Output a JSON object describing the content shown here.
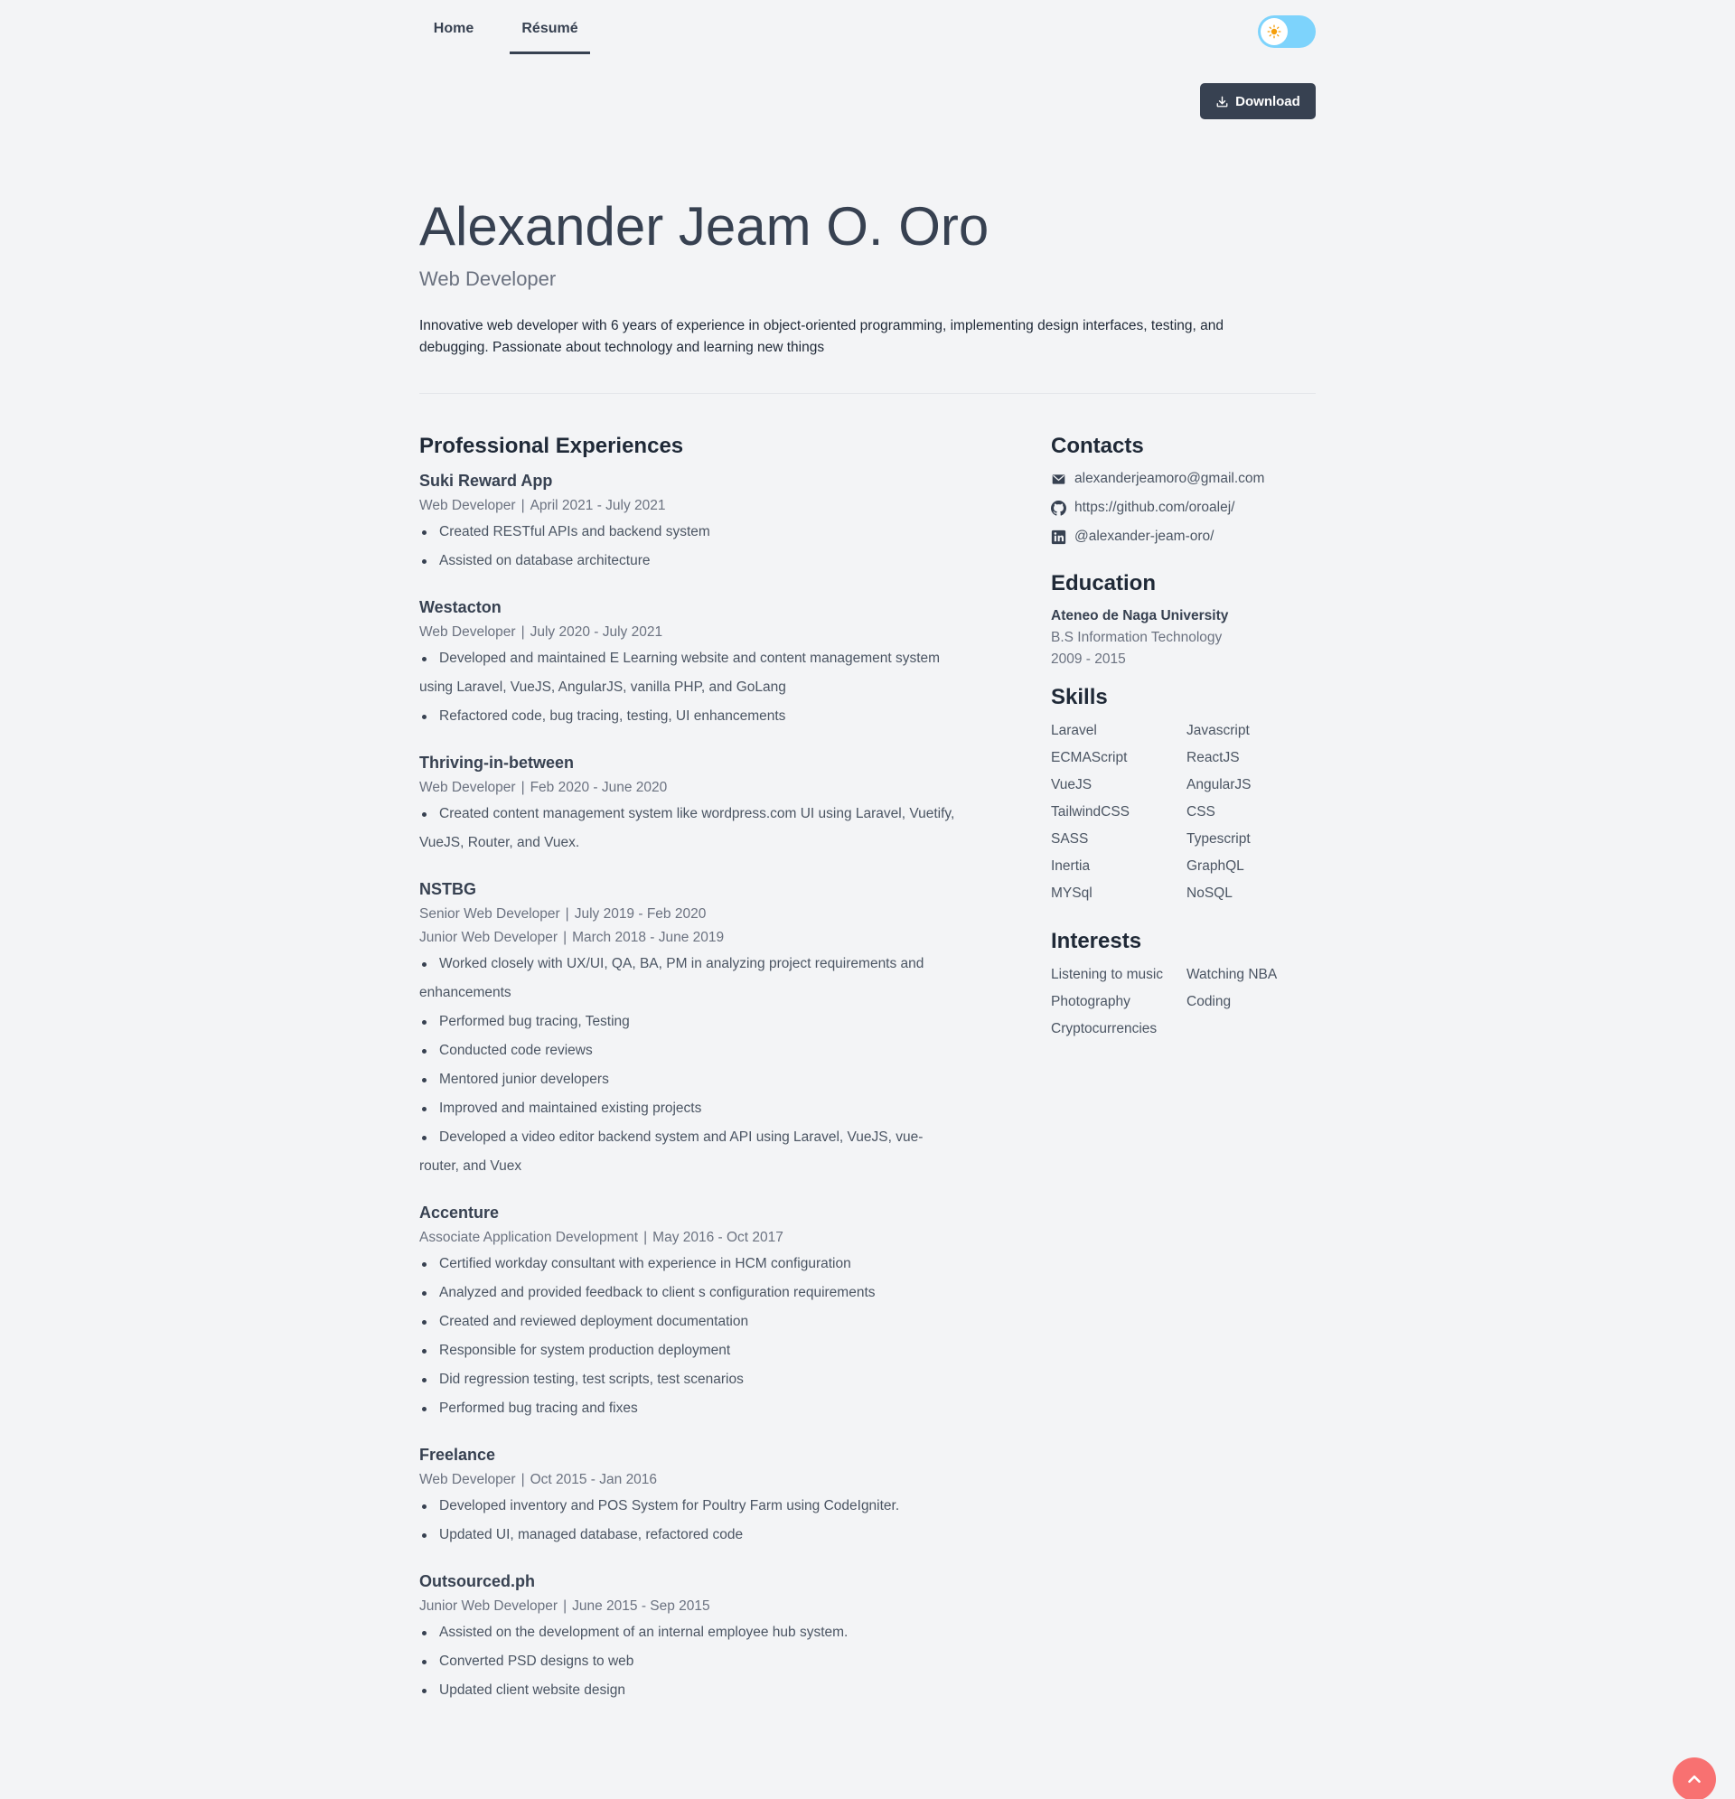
{
  "nav": {
    "tabs": [
      {
        "label": "Home"
      },
      {
        "label": "Résumé"
      }
    ]
  },
  "theme_toggle": {
    "icon": "sun-icon",
    "state": "light"
  },
  "download": {
    "label": "Download"
  },
  "profile": {
    "name": "Alexander Jeam O. Oro",
    "role": "Web Developer",
    "summary": "Innovative web developer with 6 years of experience in object-oriented programming, implementing design interfaces, testing, and debugging. Passionate about technology and learning new things"
  },
  "experience": {
    "title": "Professional Experiences",
    "jobs": [
      {
        "company": "Suki Reward App",
        "roles": [
          {
            "title": "Web Developer",
            "period": "April 2021 - July 2021"
          }
        ],
        "bullets": [
          "Created RESTful APIs and backend system",
          "Assisted on database architecture"
        ]
      },
      {
        "company": "Westacton",
        "roles": [
          {
            "title": "Web Developer",
            "period": "July 2020 - July 2021"
          }
        ],
        "bullets": [
          "Developed and maintained E Learning website and content management system using Laravel, VueJS, AngularJS, vanilla PHP, and GoLang",
          "Refactored code, bug tracing, testing, UI enhancements"
        ]
      },
      {
        "company": "Thriving-in-between",
        "roles": [
          {
            "title": "Web Developer",
            "period": "Feb 2020 - June 2020"
          }
        ],
        "bullets": [
          "Created content management system like wordpress.com UI using Laravel, Vuetify, VueJS, Router, and Vuex."
        ]
      },
      {
        "company": "NSTBG",
        "roles": [
          {
            "title": "Senior Web Developer",
            "period": "July 2019 - Feb 2020"
          },
          {
            "title": "Junior Web Developer",
            "period": "March 2018 - June 2019"
          }
        ],
        "bullets": [
          "Worked closely with UX/UI, QA, BA, PM in analyzing project requirements and enhancements",
          "Performed bug tracing, Testing",
          "Conducted code reviews",
          "Mentored junior developers",
          "Improved and maintained existing projects",
          "Developed a video editor backend system and API using Laravel, VueJS, vue-router, and Vuex"
        ]
      },
      {
        "company": "Accenture",
        "roles": [
          {
            "title": "Associate Application Development",
            "period": "May 2016 - Oct 2017"
          }
        ],
        "bullets": [
          "Certified workday consultant with experience in HCM configuration",
          "Analyzed and provided feedback to client s configuration requirements",
          "Created and reviewed deployment documentation",
          "Responsible for system production deployment",
          "Did regression testing, test scripts, test scenarios",
          "Performed bug tracing and fixes"
        ]
      },
      {
        "company": "Freelance",
        "roles": [
          {
            "title": "Web Developer",
            "period": "Oct 2015 - Jan 2016"
          }
        ],
        "bullets": [
          "Developed inventory and POS System for Poultry Farm using CodeIgniter.",
          "Updated UI, managed database, refactored code"
        ]
      },
      {
        "company": "Outsourced.ph",
        "roles": [
          {
            "title": "Junior Web Developer",
            "period": "June 2015 - Sep 2015"
          }
        ],
        "bullets": [
          "Assisted on the development of an internal employee hub system.",
          "Converted PSD designs to web",
          "Updated client website design"
        ]
      }
    ]
  },
  "contacts": {
    "title": "Contacts",
    "items": [
      {
        "icon": "mail-icon",
        "text": "alexanderjeamoro@gmail.com"
      },
      {
        "icon": "github-icon",
        "text": "https://github.com/oroalej/"
      },
      {
        "icon": "linkedin-icon",
        "text": "@alexander-jeam-oro/"
      }
    ]
  },
  "education": {
    "title": "Education",
    "school": "Ateneo de Naga University",
    "degree": "B.S Information Technology",
    "years": "2009 - 2015"
  },
  "skills": {
    "title": "Skills",
    "items": [
      "Laravel",
      "Javascript",
      "ECMAScript",
      "ReactJS",
      "VueJS",
      "AngularJS",
      "TailwindCSS",
      "CSS",
      "SASS",
      "Typescript",
      "Inertia",
      "GraphQL",
      "MYSql",
      "NoSQL"
    ]
  },
  "interests": {
    "title": "Interests",
    "items": [
      "Listening to music",
      "Watching NBA",
      "Photography",
      "Coding",
      "Cryptocurrencies"
    ]
  },
  "scroll_top": {
    "icon": "chevron-up-icon"
  },
  "colors": {
    "accent": "#374151",
    "toggle": "#7dd3fc",
    "scroll_top": "#f87171",
    "background": "#f3f4f6"
  }
}
